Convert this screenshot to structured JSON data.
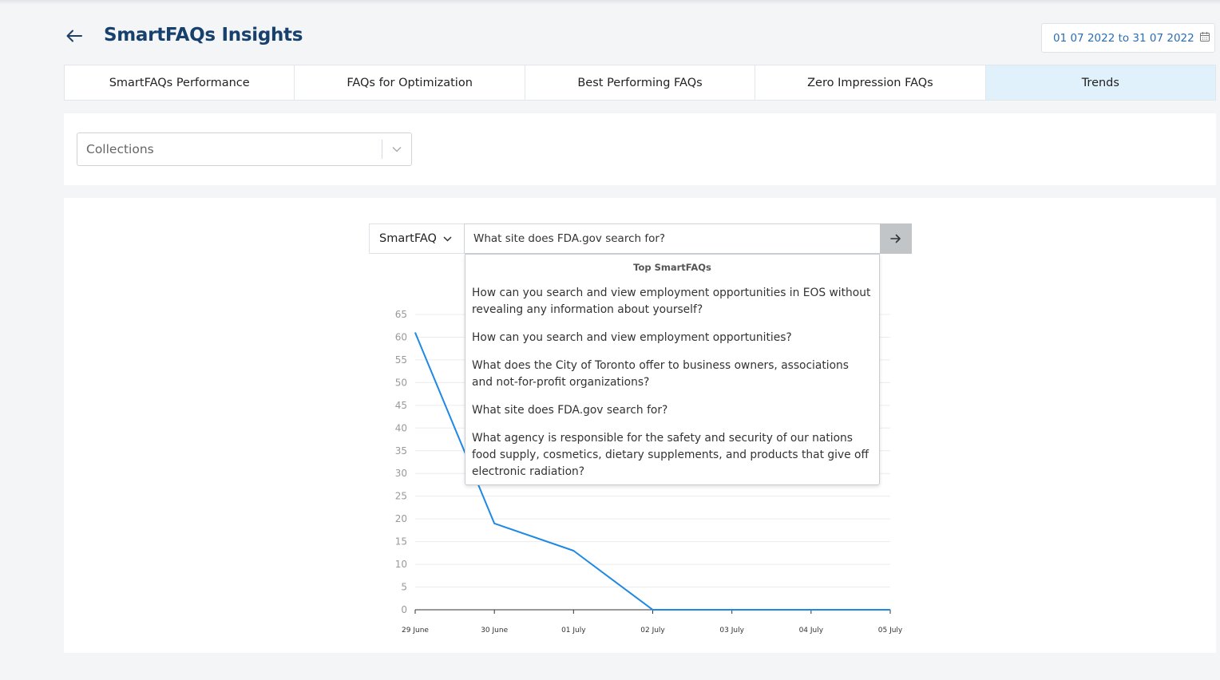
{
  "header": {
    "title": "SmartFAQs Insights",
    "date_range": "01 07 2022 to 31 07 2022"
  },
  "tabs": [
    {
      "label": "SmartFAQs Performance",
      "active": false
    },
    {
      "label": "FAQs for Optimization",
      "active": false
    },
    {
      "label": "Best Performing FAQs",
      "active": false
    },
    {
      "label": "Zero Impression FAQs",
      "active": false
    },
    {
      "label": "Trends",
      "active": true
    }
  ],
  "filters": {
    "collections_placeholder": "Collections"
  },
  "search": {
    "type_label": "SmartFAQ",
    "query": "What site does FDA.gov search for?"
  },
  "suggestions": {
    "header": "Top SmartFAQs",
    "items": [
      "How can you search and view employment opportunities in EOS without revealing any information about yourself?",
      "How can you search and view employment opportunities?",
      "What does the City of Toronto offer to business owners, associations and not-for-profit organizations?",
      "What site does FDA.gov search for?",
      "What agency is responsible for the safety and security of our nations food supply, cosmetics, dietary supplements, and products that give off electronic radiation?"
    ]
  },
  "colors": {
    "title": "#17406d",
    "accent": "#2a6db5",
    "active_tab": "#e1f1fb",
    "line": "#1e88e5"
  },
  "chart_data": {
    "type": "line",
    "categories": [
      "29 June",
      "30 June",
      "01 July",
      "02 July",
      "03 July",
      "04 July",
      "05 July"
    ],
    "series": [
      {
        "values": [
          61,
          19,
          13,
          0,
          0,
          0,
          0
        ]
      }
    ],
    "ylim": [
      0,
      65
    ],
    "yticks": [
      0,
      5,
      10,
      15,
      20,
      25,
      30,
      35,
      40,
      45,
      50,
      55,
      60,
      65
    ],
    "grid": true,
    "legend": "none"
  }
}
